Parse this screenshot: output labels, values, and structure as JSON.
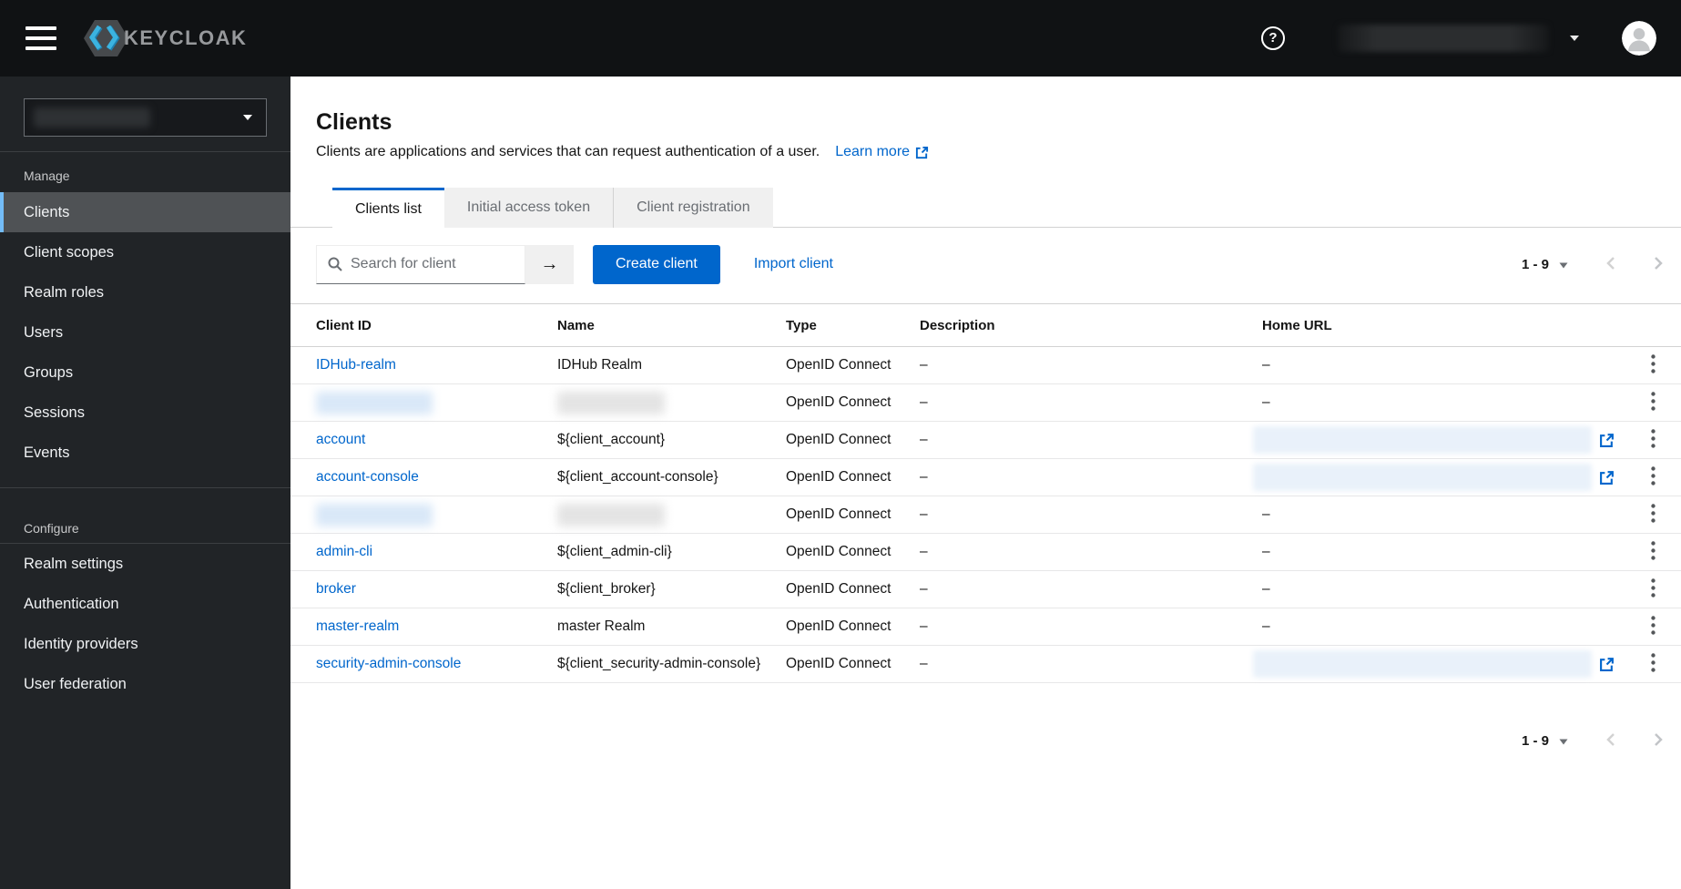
{
  "colors": {
    "accent_blue": "#0066cc",
    "header_bg": "#101214",
    "sidebar_bg": "#212427",
    "active_nav_bg": "#4f5255",
    "active_nav_accent": "#73bcf7",
    "logo_blue": "#3bb3e0",
    "table_border": "#d2d2d2"
  },
  "icons": {
    "help": "?",
    "search_submit": "→",
    "hamburger": "hamburger-icon",
    "kebab": "kebab-icon",
    "external_link": "external-link-icon",
    "search": "search-icon",
    "caret_down": "caret-down-icon",
    "chevron_left": "chevron-left-icon",
    "chevron_right": "chevron-right-icon",
    "avatar": "user-avatar-icon"
  },
  "header": {
    "brand": "KEYCLOAK"
  },
  "sidebar": {
    "realm_selector_redacted": true,
    "sections": [
      {
        "title": "Manage",
        "items": [
          {
            "label": "Clients",
            "active": true
          },
          {
            "label": "Client scopes"
          },
          {
            "label": "Realm roles"
          },
          {
            "label": "Users"
          },
          {
            "label": "Groups"
          },
          {
            "label": "Sessions"
          },
          {
            "label": "Events"
          }
        ]
      },
      {
        "title": "Configure",
        "divider_after_title": true,
        "items": [
          {
            "label": "Realm settings"
          },
          {
            "label": "Authentication"
          },
          {
            "label": "Identity providers"
          },
          {
            "label": "User federation"
          }
        ]
      }
    ]
  },
  "main": {
    "title": "Clients",
    "description": "Clients are applications and services that can request authentication of a user.",
    "learn_more": "Learn more",
    "tabs": [
      {
        "label": "Clients list",
        "active": true
      },
      {
        "label": "Initial access token",
        "active": false
      },
      {
        "label": "Client registration",
        "active": false
      }
    ],
    "toolbar": {
      "search_placeholder": "Search for client",
      "create_button": "Create client",
      "import_link": "Import client"
    },
    "pagination": {
      "range_label": "1 - 9"
    },
    "table": {
      "columns": [
        "Client ID",
        "Name",
        "Type",
        "Description",
        "Home URL"
      ],
      "rows": [
        {
          "client_id": "IDHub-realm",
          "name": "IDHub Realm",
          "type": "OpenID Connect",
          "description": "–",
          "home_url": "–"
        },
        {
          "client_id": "",
          "client_id_redacted": true,
          "name": "",
          "name_redacted": true,
          "type": "OpenID Connect",
          "description": "–",
          "home_url": "–"
        },
        {
          "client_id": "account",
          "name": "${client_account}",
          "type": "OpenID Connect",
          "description": "–",
          "home_url": "",
          "home_url_redacted": true
        },
        {
          "client_id": "account-console",
          "name": "${client_account-console}",
          "type": "OpenID Connect",
          "description": "–",
          "home_url": "",
          "home_url_redacted": true
        },
        {
          "client_id": "",
          "client_id_redacted": true,
          "name": "",
          "name_redacted": true,
          "type": "OpenID Connect",
          "description": "–",
          "home_url": "–"
        },
        {
          "client_id": "admin-cli",
          "name": "${client_admin-cli}",
          "type": "OpenID Connect",
          "description": "–",
          "home_url": "–"
        },
        {
          "client_id": "broker",
          "name": "${client_broker}",
          "type": "OpenID Connect",
          "description": "–",
          "home_url": "–"
        },
        {
          "client_id": "master-realm",
          "name": "master Realm",
          "type": "OpenID Connect",
          "description": "–",
          "home_url": "–"
        },
        {
          "client_id": "security-admin-console",
          "name": "${client_security-admin-console}",
          "type": "OpenID Connect",
          "description": "–",
          "home_url": "",
          "home_url_redacted": true
        }
      ]
    }
  }
}
